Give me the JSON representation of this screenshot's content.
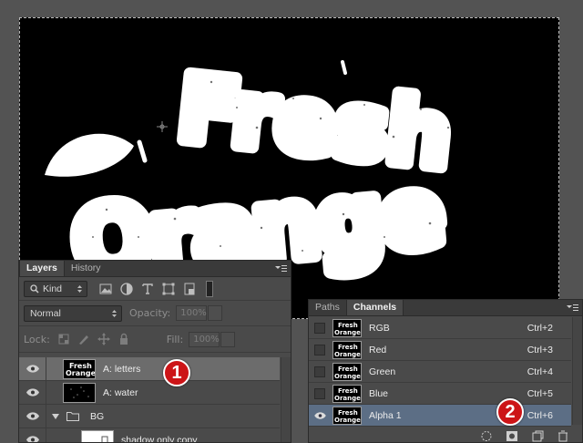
{
  "colors": {
    "canvas_bg": "#000000",
    "artwork": "#ffffff",
    "panel_bg": "#4a4a4a",
    "selected_layer": "#6c6c6c",
    "selected_channel": "#5c6e85",
    "badge": "#cc1417"
  },
  "artwork_text": {
    "line1": "Fresh",
    "line2": "Orange"
  },
  "layers_panel": {
    "tabs": [
      "Layers",
      "History"
    ],
    "active_tab": "Layers",
    "filter_kind": "Kind",
    "blend_mode": "Normal",
    "opacity_label": "Opacity:",
    "opacity_value": "100%",
    "lock_label": "Lock:",
    "fill_label": "Fill:",
    "fill_value": "100%",
    "layers": [
      {
        "name": "A: letters",
        "selected": true,
        "visible": true
      },
      {
        "name": "A: water",
        "selected": false,
        "visible": true
      },
      {
        "name": "BG",
        "type": "group",
        "expanded": true,
        "visible": true
      },
      {
        "name": "shadow only copy",
        "selected": false,
        "visible": true
      }
    ],
    "icons": [
      "eye-icon",
      "folder-icon",
      "image-filter-icon",
      "adjustment-filter-icon",
      "type-filter-icon",
      "shape-filter-icon",
      "smart-object-filter-icon"
    ]
  },
  "channels_panel": {
    "tabs": [
      "Paths",
      "Channels"
    ],
    "active_tab": "Channels",
    "channels": [
      {
        "name": "RGB",
        "shortcut": "Ctrl+2",
        "selected": false,
        "visible": false
      },
      {
        "name": "Red",
        "shortcut": "Ctrl+3",
        "selected": false,
        "visible": false
      },
      {
        "name": "Green",
        "shortcut": "Ctrl+4",
        "selected": false,
        "visible": false
      },
      {
        "name": "Blue",
        "shortcut": "Ctrl+5",
        "selected": false,
        "visible": false
      },
      {
        "name": "Alpha 1",
        "shortcut": "Ctrl+6",
        "selected": true,
        "visible": true
      }
    ],
    "footer_icons": [
      "load-selection-icon",
      "save-selection-icon",
      "new-channel-icon",
      "delete-channel-icon"
    ]
  },
  "badges": {
    "one": "1",
    "two": "2"
  }
}
